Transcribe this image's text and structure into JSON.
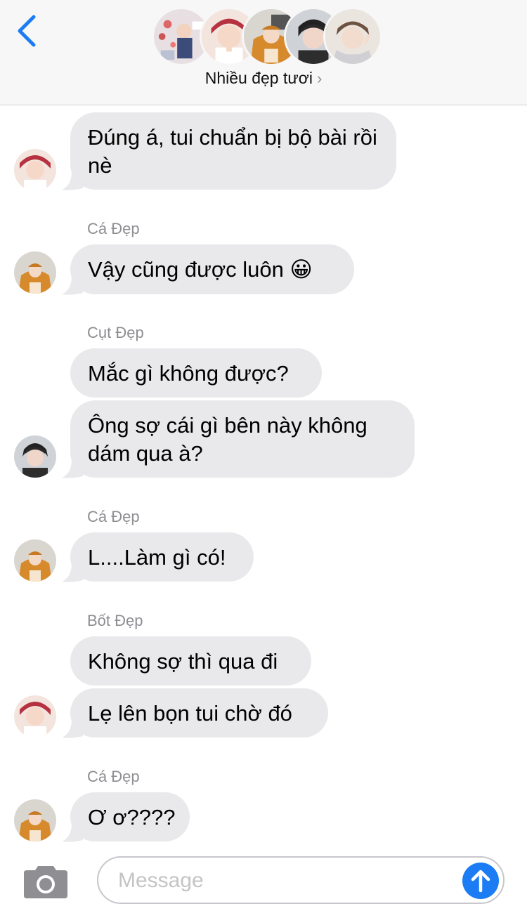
{
  "header": {
    "group_name": "Nhiều đẹp tươi",
    "chevron": "›",
    "back_icon": "chevron-left-icon",
    "accent_color": "#1b7cf4"
  },
  "messages": [
    {
      "sender": "",
      "lines": "Đúng á, tui chuẩn bị bộ bài rồi nè"
    },
    {
      "sender": "Cá Đẹp",
      "lines": "Vậy cũng được luôn 😀"
    },
    {
      "sender": "Cụt Đẹp",
      "lines": "Mắc gì không được?"
    },
    {
      "sender": "",
      "lines": "Ông sợ cái gì bên này không dám qua à?"
    },
    {
      "sender": "Cá Đẹp",
      "lines": "L....Làm gì có!"
    },
    {
      "sender": "Bốt Đẹp",
      "lines": "Không sợ thì qua đi"
    },
    {
      "sender": "",
      "lines": "Lẹ lên bọn tui chờ đó"
    },
    {
      "sender": "Cá Đẹp",
      "lines": "Ơ ơ????"
    }
  ],
  "composer": {
    "placeholder": "Message",
    "camera_icon": "camera-icon",
    "send_icon": "arrow-up-icon"
  }
}
